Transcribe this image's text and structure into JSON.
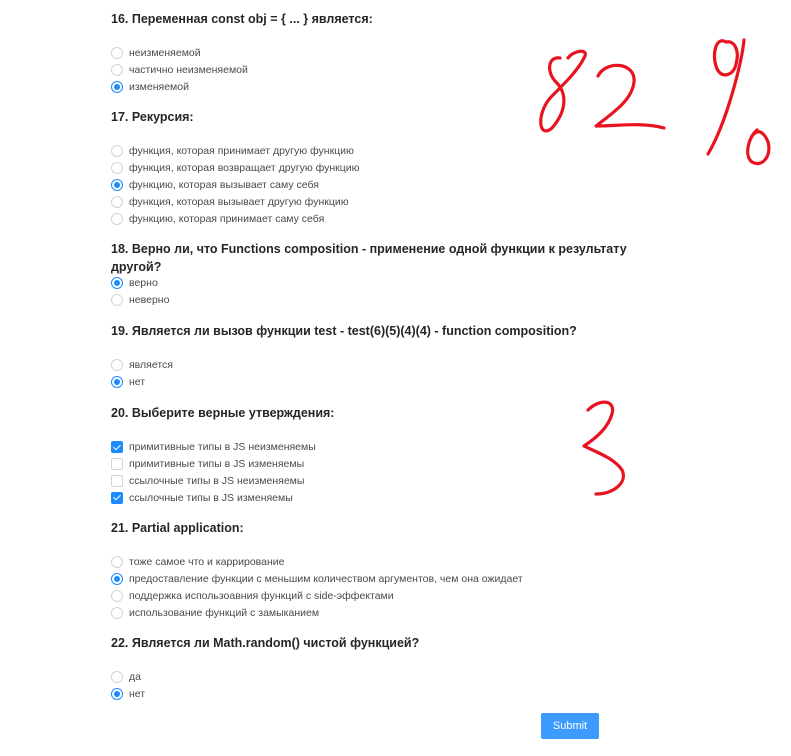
{
  "questions": [
    {
      "title": "16. Переменная const obj = { ... } является:",
      "type": "radio",
      "options": [
        {
          "label": "неизменяемой",
          "selected": false
        },
        {
          "label": "частично неизменяемой",
          "selected": false
        },
        {
          "label": "изменяемой",
          "selected": true
        }
      ]
    },
    {
      "title": "17. Рекурсия:",
      "type": "radio",
      "options": [
        {
          "label": "функция, которая принимает другую функцию",
          "selected": false
        },
        {
          "label": "функция, которая возвращает другую функцию",
          "selected": false
        },
        {
          "label": "функцию, которая вызывает саму себя",
          "selected": true
        },
        {
          "label": "функция, которая вызывает другую функцию",
          "selected": false
        },
        {
          "label": "функцию, которая принимает саму себя",
          "selected": false
        }
      ]
    },
    {
      "title": "18. Верно ли, что Functions composition - применение одной функции к результату другой?",
      "type": "radio",
      "options": [
        {
          "label": "верно",
          "selected": true
        },
        {
          "label": "неверно",
          "selected": false
        }
      ]
    },
    {
      "title": "19. Является ли вызов функции test - test(6)(5)(4)(4) - function composition?",
      "type": "radio",
      "options": [
        {
          "label": "является",
          "selected": false
        },
        {
          "label": "нет",
          "selected": true
        }
      ]
    },
    {
      "title": "20. Выберите верные утверждения:",
      "type": "checkbox",
      "options": [
        {
          "label": "примитивные типы в JS неизменяемы",
          "selected": true
        },
        {
          "label": "примитивные типы в JS изменяемы",
          "selected": false
        },
        {
          "label": "ссылочные типы в JS неизменяемы",
          "selected": false
        },
        {
          "label": "ссылочные типы в JS изменяемы",
          "selected": true
        }
      ]
    },
    {
      "title": "21. Partial application:",
      "type": "radio",
      "options": [
        {
          "label": "тоже самое что и каррирование",
          "selected": false
        },
        {
          "label": "предоставление функции с меньшим количеством аргументов, чем она ожидает",
          "selected": true
        },
        {
          "label": "поддержка использоавния функций с side-эффектами",
          "selected": false
        },
        {
          "label": "использование функций с замыканием",
          "selected": false
        }
      ]
    },
    {
      "title": "22. Является ли Math.random() чистой функцией?",
      "type": "radio",
      "options": [
        {
          "label": "да",
          "selected": false
        },
        {
          "label": "нет",
          "selected": true
        }
      ]
    }
  ],
  "submit_label": "Submit",
  "annotations": {
    "score_text": "82%",
    "mark_text": "3",
    "ink_color": "#e8131f"
  },
  "colors": {
    "accent": "#1a8cff",
    "button": "#3d9bff"
  }
}
